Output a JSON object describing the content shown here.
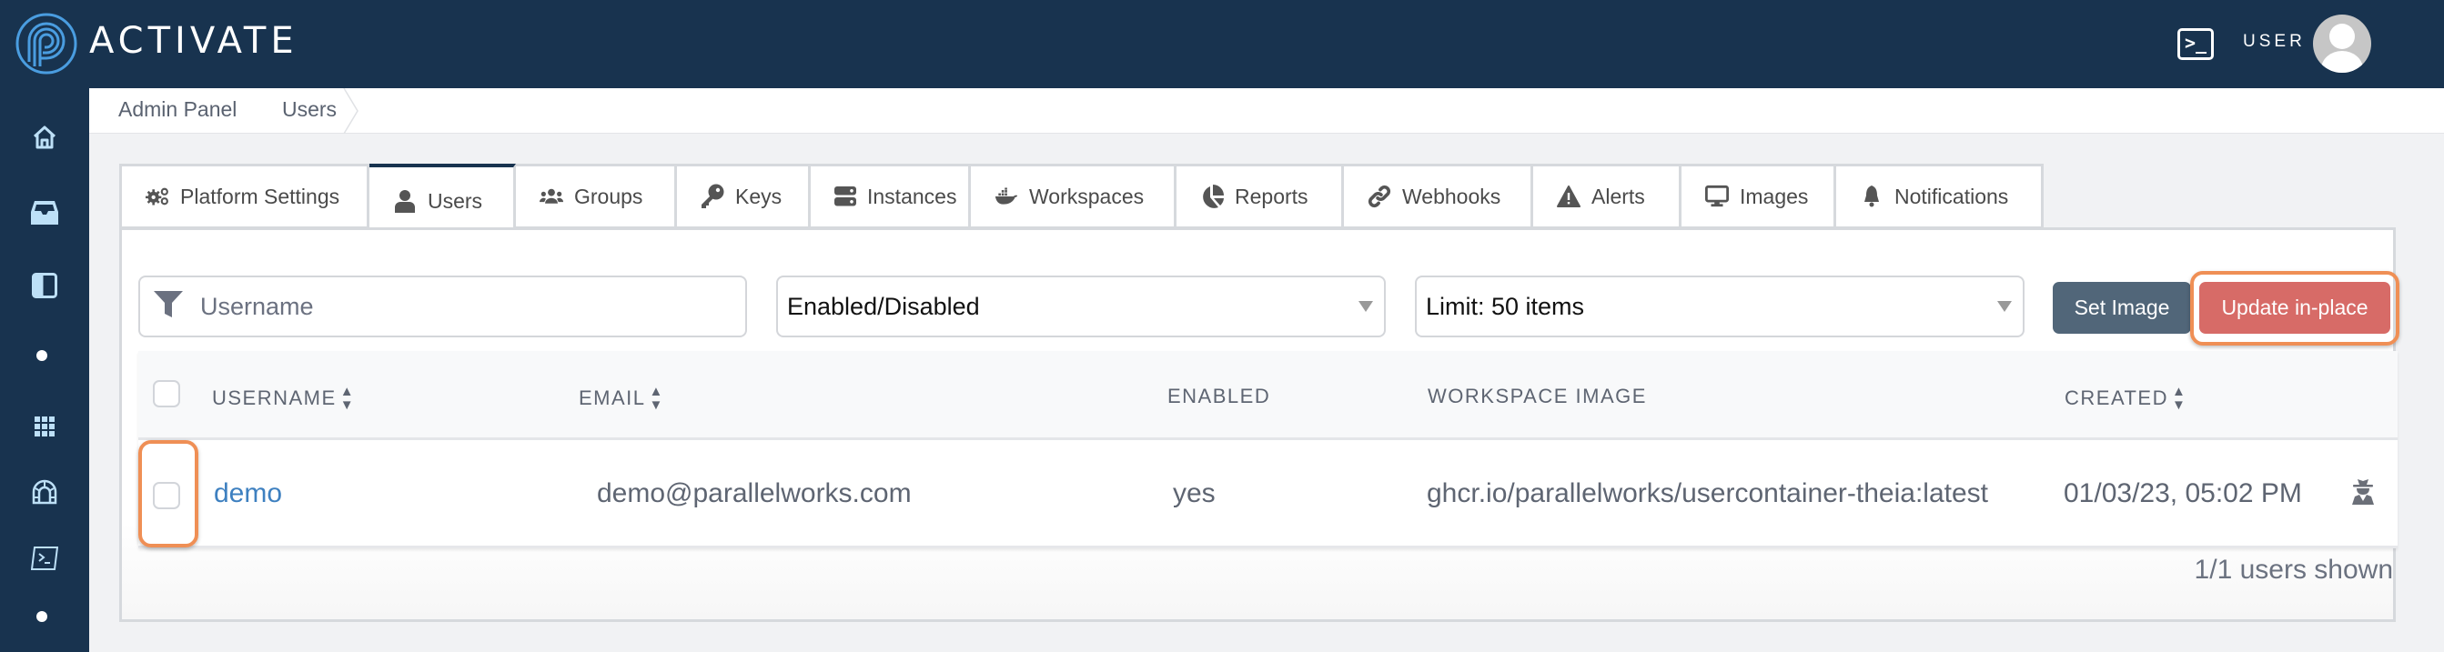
{
  "header": {
    "brand": "ACTIVATE",
    "terminal_icon": "terminal-icon",
    "user_label": "USER",
    "avatar_icon": "user-avatar-icon"
  },
  "sidebar": {
    "items": [
      {
        "icon": "home-icon"
      },
      {
        "icon": "inbox-icon"
      },
      {
        "icon": "sidebar-panel-icon"
      },
      {
        "icon": "dot-separator"
      },
      {
        "icon": "apps-grid-icon"
      },
      {
        "icon": "tunnel-icon"
      },
      {
        "icon": "terminal-icon"
      },
      {
        "icon": "dot-separator"
      }
    ]
  },
  "breadcrumb": {
    "items": [
      "Admin Panel",
      "Users"
    ]
  },
  "tabs": [
    {
      "label": "Platform Settings",
      "icon": "gears-icon",
      "active": false
    },
    {
      "label": "Users",
      "icon": "user-icon",
      "active": true
    },
    {
      "label": "Groups",
      "icon": "users-group-icon",
      "active": false
    },
    {
      "label": "Keys",
      "icon": "key-icon",
      "active": false
    },
    {
      "label": "Instances",
      "icon": "server-icon",
      "active": false
    },
    {
      "label": "Workspaces",
      "icon": "docker-icon",
      "active": false
    },
    {
      "label": "Reports",
      "icon": "pie-chart-icon",
      "active": false
    },
    {
      "label": "Webhooks",
      "icon": "link-icon",
      "active": false
    },
    {
      "label": "Alerts",
      "icon": "warning-icon",
      "active": false
    },
    {
      "label": "Images",
      "icon": "monitor-icon",
      "active": false
    },
    {
      "label": "Notifications",
      "icon": "bell-icon",
      "active": false
    }
  ],
  "filters": {
    "username_placeholder": "Username",
    "username_value": "",
    "enabled_select": "Enabled/Disabled",
    "limit_select": "Limit: 50 items"
  },
  "actions": {
    "set_image": "Set Image",
    "update_in_place": "Update in-place"
  },
  "table": {
    "columns": [
      {
        "label": "USERNAME",
        "sortable": true
      },
      {
        "label": "EMAIL",
        "sortable": true
      },
      {
        "label": "ENABLED",
        "sortable": false
      },
      {
        "label": "WORKSPACE IMAGE",
        "sortable": false
      },
      {
        "label": "CREATED",
        "sortable": true
      }
    ],
    "rows": [
      {
        "username": "demo",
        "email": "demo@parallelworks.com",
        "enabled": "yes",
        "workspace_image": "ghcr.io/parallelworks/usercontainer-theia:latest",
        "created": "01/03/23, 05:02 PM",
        "action_icon": "user-secret-icon"
      }
    ]
  },
  "footer": {
    "count_text": "1/1 users shown"
  },
  "colors": {
    "navy": "#18334f",
    "accent_blue": "#3e80c0",
    "set_image_button": "#516679",
    "update_button": "#d76b67",
    "highlight_orange": "#ef8f55"
  }
}
